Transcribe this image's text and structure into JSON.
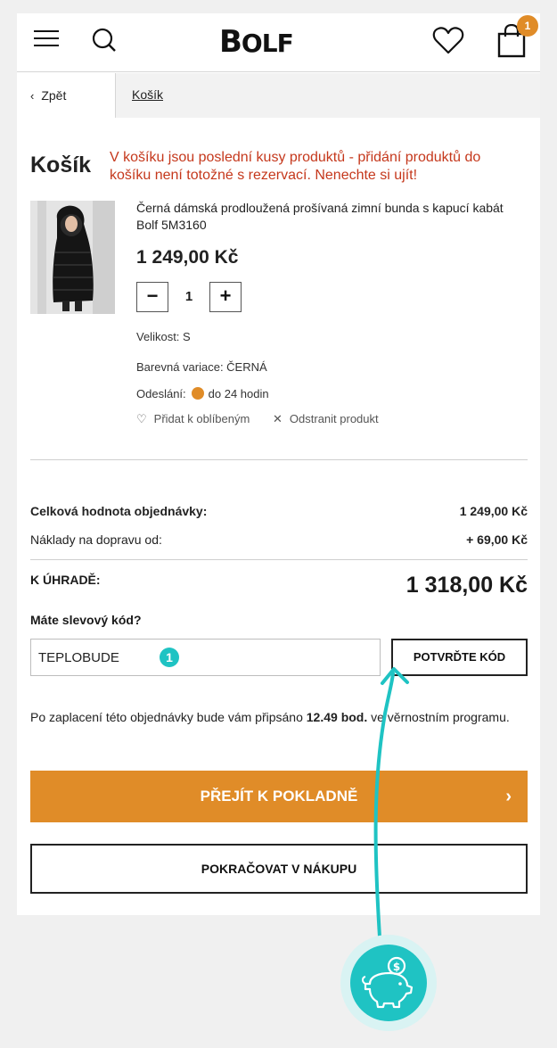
{
  "header": {
    "logo_text": "Bolf",
    "cart_count": "1",
    "icons": [
      "menu-icon",
      "search-icon",
      "heart-icon",
      "shopping-bag-icon"
    ]
  },
  "breadcrumb": {
    "back_label": "Zpět",
    "current": "Košík"
  },
  "cart": {
    "title": "Košík",
    "warning": "V košíku jsou poslední kusy produktů - přidání produktů do košíku není totožné s rezervací. Nenechte si ujít!"
  },
  "product": {
    "name": "Černá dámská prodloužená prošívaná zimní bunda s kapucí kabát Bolf 5M3160",
    "price": "1 249,00 Kč",
    "quantity": "1",
    "size": "Velikost: S",
    "color": "Barevná variace: ČERNÁ",
    "shipping_label": "Odeslání:",
    "shipping_value": "do 24 hodin",
    "add_favorite": "Přidat k oblíbeným",
    "remove": "Odstranit produkt"
  },
  "summary": {
    "order_value_label": "Celková hodnota objednávky:",
    "order_value": "1 249,00 Kč",
    "shipping_label": "Náklady na dopravu od:",
    "shipping_value": "+ 69,00 Kč",
    "total_label": "K ÚHRADĚ:",
    "total_value": "1 318,00 Kč"
  },
  "discount": {
    "question": "Máte slevový kód?",
    "code_value": "TEPLOBUDE",
    "confirm_label": "POTVRĎTE KÓD",
    "marker": "1"
  },
  "loyalty": {
    "text_before": "Po zaplacení této objednávky bude vám připsáno ",
    "points": "12.49 bod.",
    "text_after": " ve věrnostním programu."
  },
  "actions": {
    "checkout": "PŘEJÍT K POKLADNĚ",
    "continue": "POKRAČOVAT V NÁKUPU"
  },
  "colors": {
    "accent": "#e08c28",
    "warning": "#c5381c",
    "callout": "#1fc3c3"
  }
}
